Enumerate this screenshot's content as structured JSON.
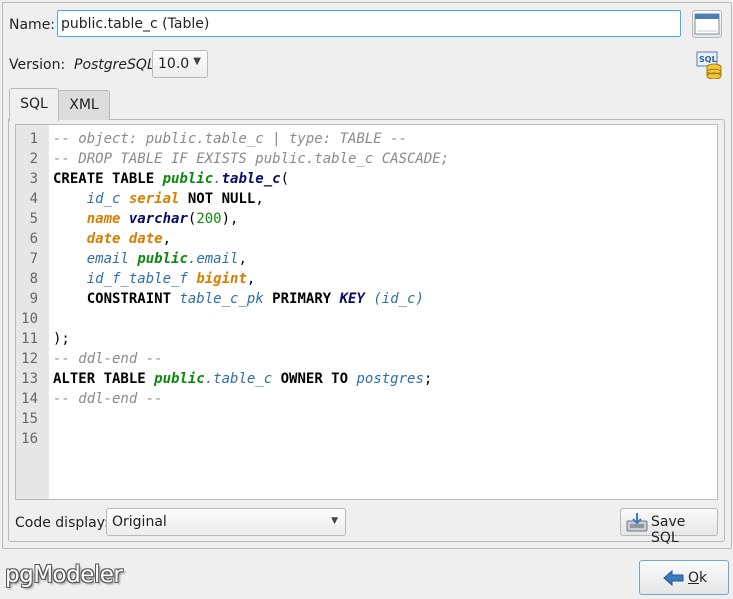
{
  "form": {
    "name_label": "Name:",
    "name_value": "public.table_c (Table)",
    "version_label": "Version:",
    "version_db": "PostgreSQL",
    "version_value": "10.0"
  },
  "tabs": [
    {
      "label": "SQL",
      "active": true
    },
    {
      "label": "XML",
      "active": false
    }
  ],
  "code_lines": [
    {
      "n": "1",
      "tokens": [
        {
          "t": "-- object: public.table_c | type: TABLE --",
          "c": "t-comment"
        }
      ]
    },
    {
      "n": "2",
      "tokens": [
        {
          "t": "-- DROP TABLE IF EXISTS public.table_c CASCADE;",
          "c": "t-comment"
        }
      ]
    },
    {
      "n": "3",
      "tokens": [
        {
          "t": "CREATE TABLE ",
          "c": "t-kw"
        },
        {
          "t": "public",
          "c": "t-schema"
        },
        {
          "t": ".",
          "c": "t-dot"
        },
        {
          "t": "table_c",
          "c": "t-table"
        },
        {
          "t": "(",
          "c": "t-plain"
        }
      ]
    },
    {
      "n": "4",
      "tokens": [
        {
          "t": "    ",
          "c": "t-plain"
        },
        {
          "t": "id_c",
          "c": "t-ident"
        },
        {
          "t": " ",
          "c": "t-plain"
        },
        {
          "t": "serial",
          "c": "t-type"
        },
        {
          "t": " NOT NULL",
          "c": "t-kw"
        },
        {
          "t": ",",
          "c": "t-plain"
        }
      ]
    },
    {
      "n": "5",
      "tokens": [
        {
          "t": "    ",
          "c": "t-plain"
        },
        {
          "t": "name",
          "c": "t-type"
        },
        {
          "t": " ",
          "c": "t-plain"
        },
        {
          "t": "varchar",
          "c": "t-type2"
        },
        {
          "t": "(",
          "c": "t-plain"
        },
        {
          "t": "200",
          "c": "t-num"
        },
        {
          "t": "),",
          "c": "t-plain"
        }
      ]
    },
    {
      "n": "6",
      "tokens": [
        {
          "t": "    ",
          "c": "t-plain"
        },
        {
          "t": "date",
          "c": "t-type"
        },
        {
          "t": " ",
          "c": "t-plain"
        },
        {
          "t": "date",
          "c": "t-type"
        },
        {
          "t": ",",
          "c": "t-plain"
        }
      ]
    },
    {
      "n": "7",
      "tokens": [
        {
          "t": "    ",
          "c": "t-plain"
        },
        {
          "t": "email",
          "c": "t-ident"
        },
        {
          "t": " ",
          "c": "t-plain"
        },
        {
          "t": "public",
          "c": "t-schema"
        },
        {
          "t": ".email",
          "c": "t-dot"
        },
        {
          "t": ",",
          "c": "t-plain"
        }
      ]
    },
    {
      "n": "8",
      "tokens": [
        {
          "t": "    ",
          "c": "t-plain"
        },
        {
          "t": "id_f_table_f",
          "c": "t-ident"
        },
        {
          "t": " ",
          "c": "t-plain"
        },
        {
          "t": "bigint",
          "c": "t-type"
        },
        {
          "t": ",",
          "c": "t-plain"
        }
      ]
    },
    {
      "n": "9",
      "tokens": [
        {
          "t": "    ",
          "c": "t-plain"
        },
        {
          "t": "CONSTRAINT",
          "c": "t-kw"
        },
        {
          "t": " ",
          "c": "t-plain"
        },
        {
          "t": "table_c_pk",
          "c": "t-ident"
        },
        {
          "t": " PRIMARY ",
          "c": "t-kw"
        },
        {
          "t": "KEY",
          "c": "t-navy"
        },
        {
          "t": " ",
          "c": "t-plain"
        },
        {
          "t": "(id_c)",
          "c": "t-ident"
        }
      ]
    },
    {
      "n": "10",
      "tokens": []
    },
    {
      "n": "11",
      "tokens": [
        {
          "t": ");",
          "c": "t-plain"
        }
      ]
    },
    {
      "n": "12",
      "tokens": [
        {
          "t": "-- ddl-end --",
          "c": "t-comment"
        }
      ]
    },
    {
      "n": "13",
      "tokens": [
        {
          "t": "ALTER TABLE ",
          "c": "t-kw"
        },
        {
          "t": "public",
          "c": "t-schema"
        },
        {
          "t": ".table_c",
          "c": "t-dot"
        },
        {
          "t": " OWNER TO ",
          "c": "t-kw"
        },
        {
          "t": "postgres",
          "c": "t-owner"
        },
        {
          "t": ";",
          "c": "t-plain"
        }
      ]
    },
    {
      "n": "14",
      "tokens": [
        {
          "t": "-- ddl-end --",
          "c": "t-comment"
        }
      ]
    },
    {
      "n": "15",
      "tokens": []
    },
    {
      "n": "16",
      "tokens": []
    }
  ],
  "bottom": {
    "code_display_label": "Code display:",
    "code_display_value": "Original",
    "save_sql_label": "Save SQL"
  },
  "footer": {
    "logo_text": "pgModeler",
    "ok_label": "Ok",
    "ok_underline_index": 0
  },
  "colors": {
    "accent": "#3daee9",
    "comment": "#8a8a8a",
    "schema": "#0a8a0a",
    "type": "#d67f00",
    "identifier": "#2d6fa8"
  }
}
